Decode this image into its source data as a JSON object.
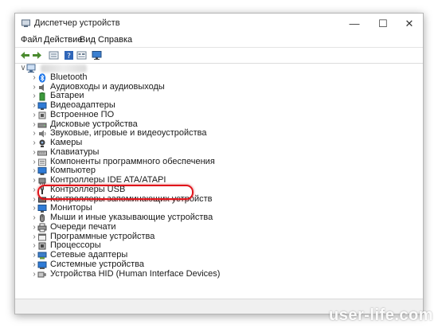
{
  "window": {
    "title": "Диспетчер устройств",
    "minimize_glyph": "—",
    "maximize_glyph": "☐",
    "close_glyph": "✕"
  },
  "menu": [
    "Файл",
    "Действие",
    "Вид",
    "Справка"
  ],
  "toolbar": [
    "back-arrow-icon",
    "forward-arrow-icon",
    "properties-icon",
    "help-icon",
    "details-view-icon",
    "monitor-icon"
  ],
  "tree": {
    "root_expander": "∨",
    "collapsed_expander": "›",
    "categories": [
      {
        "label": "Bluetooth",
        "icon": "bluetooth-icon"
      },
      {
        "label": "Аудиовходы и аудиовыходы",
        "icon": "speaker-icon"
      },
      {
        "label": "Батареи",
        "icon": "battery-icon"
      },
      {
        "label": "Видеоадаптеры",
        "icon": "display-adapter-icon"
      },
      {
        "label": "Встроенное ПО",
        "icon": "firmware-icon"
      },
      {
        "label": "Дисковые устройства",
        "icon": "disk-icon"
      },
      {
        "label": "Звуковые, игровые и видеоустройства",
        "icon": "sound-device-icon"
      },
      {
        "label": "Камеры",
        "icon": "camera-icon"
      },
      {
        "label": "Клавиатуры",
        "icon": "keyboard-icon"
      },
      {
        "label": "Компоненты программного обеспечения",
        "icon": "software-component-icon"
      },
      {
        "label": "Компьютер",
        "icon": "computer-icon"
      },
      {
        "label": "Контроллеры IDE ATA/ATAPI",
        "icon": "ide-controller-icon"
      },
      {
        "label": "Контроллеры USB",
        "icon": "usb-icon"
      },
      {
        "label": "Контроллеры запоминающих устройств",
        "icon": "storage-controller-icon"
      },
      {
        "label": "Мониторы",
        "icon": "monitor-icon"
      },
      {
        "label": "Мыши и иные указывающие устройства",
        "icon": "mouse-icon"
      },
      {
        "label": "Очереди печати",
        "icon": "printer-icon"
      },
      {
        "label": "Программные устройства",
        "icon": "software-device-icon"
      },
      {
        "label": "Процессоры",
        "icon": "processor-icon"
      },
      {
        "label": "Сетевые адаптеры",
        "icon": "network-adapter-icon"
      },
      {
        "label": "Системные устройства",
        "icon": "system-device-icon"
      },
      {
        "label": "Устройства HID (Human Interface Devices)",
        "icon": "hid-icon"
      }
    ]
  },
  "highlighted_item": "Звуковые, игровые и видеоустройства",
  "watermark": "user-life.com",
  "colors": {
    "highlight": "#e0141b",
    "bluetooth": "#1a73e8",
    "icon_gray": "#6b6b6b"
  }
}
